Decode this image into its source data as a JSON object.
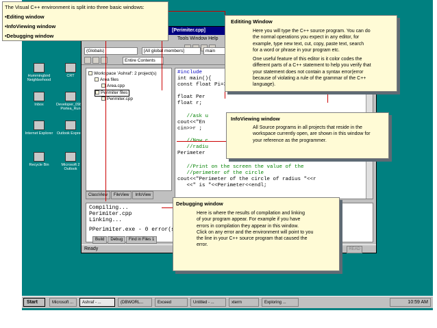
{
  "intro": {
    "line1": "The Visual C++ environment is split into three basic windows:",
    "line2": "•Editing window",
    "line3": "•InfoViewing  window",
    "line4": "•Debugging window"
  },
  "desktop_icons": [
    {
      "label": "Hummingbird Neighborhood"
    },
    {
      "label": "CRT"
    },
    {
      "label": "Inbox"
    },
    {
      "label": "Developer_098 8 Portea_Run"
    },
    {
      "label": "Internet Explorer"
    },
    {
      "label": "Outlook Express"
    },
    {
      "label": "Recycle Bin"
    },
    {
      "label": "Microsoft 2 Outlook"
    }
  ],
  "vc": {
    "title": "[Perimiter.cpp]",
    "menu": "Tools  Window  Help",
    "combo_globals": "(Globals)",
    "combo_members": "[All global members]",
    "combo_main": "main",
    "combo_contents": "Entire Contents",
    "workspace": {
      "root": "Workspace 'Ashraf': 2 project(s)",
      "area": "Area files",
      "area_file": "Area.cpp",
      "perim": "Perimiter files",
      "perim_file": "Perimiter.cpp"
    },
    "ws_tabs": [
      "ClassView",
      "FileView",
      "InfoView"
    ],
    "code": [
      "#include",
      "int main(){",
      "const float Pi=3.14159f;",
      "",
      "float Per",
      "float r;",
      "",
      "   //ask u",
      "cout<<\"En",
      "cin>>r ;",
      "",
      "   //Now c",
      "   //radiu",
      "Perimeter",
      "",
      "   //Print on the screen the value of the",
      "   //perimeter of the circle",
      "cout<<\"Perimeter of the circle of radius \"<<r",
      "   <<\" is \"<<Perimeter<<endl;"
    ],
    "output": [
      "Compiling...",
      "Perimiter.cpp",
      "Linking...",
      "",
      "PPerimiter.exe - 0 error(s"
    ],
    "out_tabs": [
      "Build",
      "Debug",
      "Find in Files 1"
    ],
    "status": "Ready",
    "status_ro": "READ"
  },
  "taskbar": {
    "start": "Start",
    "items": [
      "Microsoft ...",
      "Ashraf - ...",
      "(DBWORL...",
      "Exceed",
      "Untitled - ...",
      "xterm",
      "Exploring ..."
    ],
    "clock": "10:59 AM"
  },
  "callouts": {
    "edit": {
      "heading": "Edititing Window",
      "p1": [
        "Here you will type the C++ source program. You can do",
        "the normal operations you expect in any editor, for",
        "example, type new text, cut, copy, paste text, search",
        "for a word or phrase in your program etc."
      ],
      "p2": [
        "One useful feature of this editor is it color codes the",
        "different parts of a C++ statement to help you verify that",
        "your statement does not contain a syntax error(error",
        "because of violating a rule of the grammar of the C++",
        "language)."
      ]
    },
    "info": {
      "heading": "InfoViewing window",
      "lines": [
        "All Source programs in all  projects that reside in the",
        "workspace currently open, are shown in this window for",
        "your reference as the programmer."
      ]
    },
    "debug": {
      "heading": "Debugging window",
      "lines": [
        "Here is where the results of compilation and linking",
        "of your program appear. For example if you  have",
        "errors in compilation they appear in this window.",
        "Click on any error and the environment will point to you",
        "the line in your C++ source program that caused the",
        "error."
      ]
    }
  }
}
